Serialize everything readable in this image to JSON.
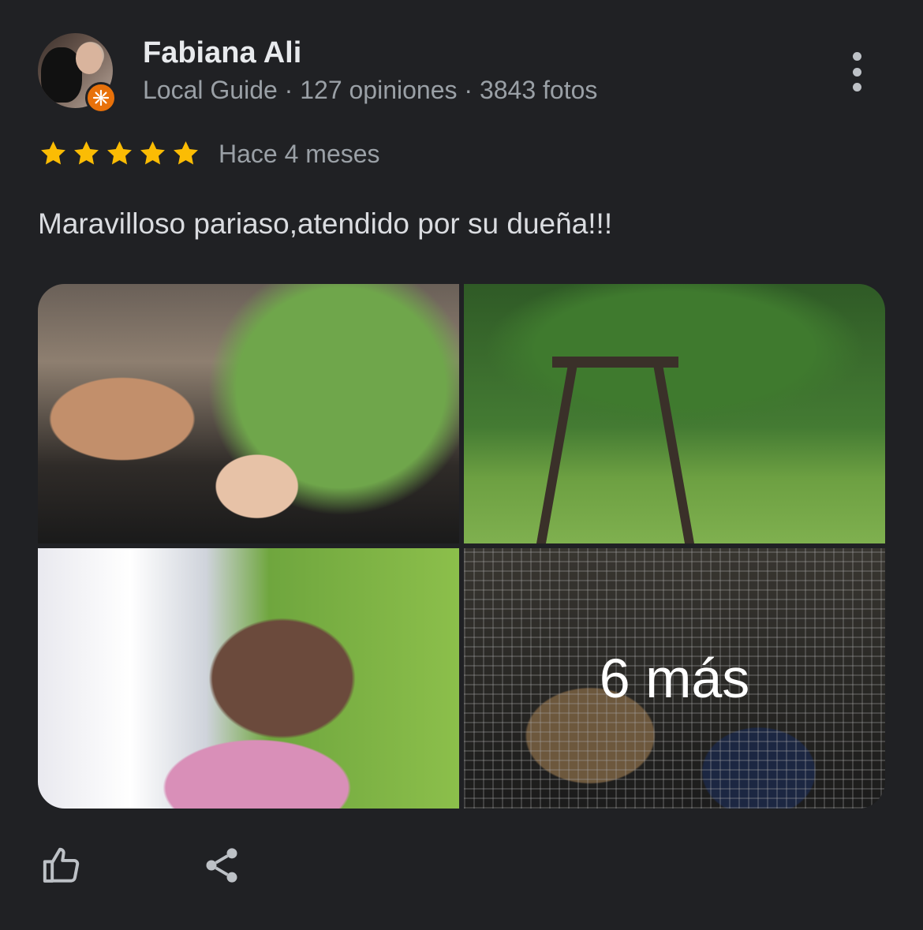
{
  "reviewer": {
    "name": "Fabiana Ali",
    "meta": "Local Guide · 127 opiniones · 3843 fotos",
    "avatar_icon": "avatar-photo",
    "badge_icon": "local-guide-badge-icon",
    "badge_color": "#e8710a"
  },
  "rating": {
    "stars": 5,
    "max_stars": 5,
    "star_color": "#fbbc04",
    "time_ago": "Hace 4 meses"
  },
  "review": {
    "text": "Maravilloso pariaso,atendido por su dueña!!!"
  },
  "photos": {
    "more_label": "6 más"
  },
  "actions": {
    "like_icon": "thumbs-up-icon",
    "share_icon": "share-icon"
  },
  "menu_icon": "more-vert-icon"
}
